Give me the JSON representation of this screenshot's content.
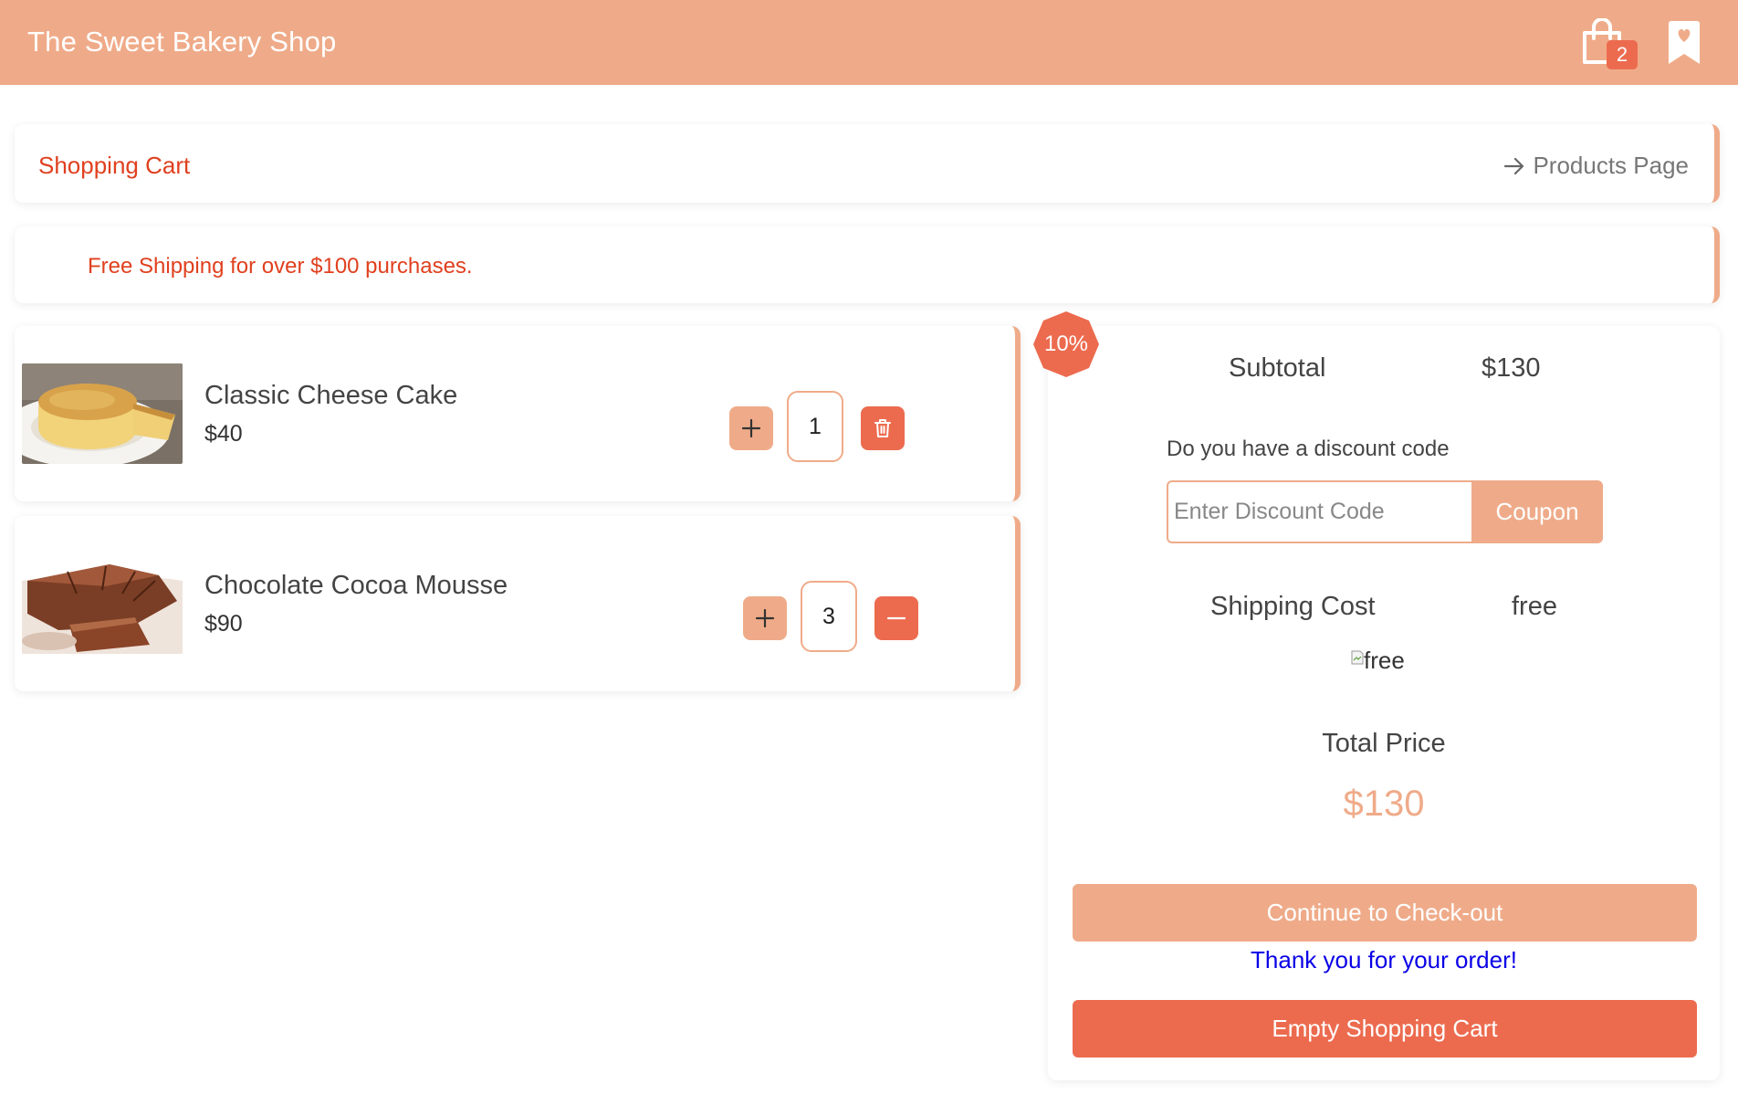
{
  "header": {
    "title": "The Sweet Bakery Shop",
    "cart_count": "2",
    "cart_icon": "shopping-bag-icon",
    "bookmark_icon": "bookmark-heart-icon"
  },
  "breadcrumb": {
    "title": "Shopping Cart",
    "products_link": "Products Page",
    "arrow_icon": "arrow-right-icon"
  },
  "notice": {
    "text": "Free Shipping for over $100 purchases."
  },
  "cart_items": [
    {
      "name": "Classic Cheese Cake",
      "price": "$40",
      "quantity": "1",
      "image_icon": "cheesecake-image",
      "plus_icon": "plus-icon",
      "remove_icon": "trash-icon"
    },
    {
      "name": "Chocolate Cocoa Mousse",
      "price": "$90",
      "quantity": "3",
      "image_icon": "chocolate-cake-image",
      "plus_icon": "plus-icon",
      "remove_icon": "minus-icon"
    }
  ],
  "summary": {
    "discount_badge": "10%",
    "subtotal_label": "Subtotal",
    "subtotal_value": "$130",
    "discount_question": "Do you have a discount code",
    "discount_placeholder": "Enter Discount Code",
    "coupon_label": "Coupon",
    "shipping_label": "Shipping Cost",
    "shipping_value": "free",
    "shipping_image_alt": "free",
    "total_label": "Total Price",
    "total_value": "$130",
    "checkout_label": "Continue to Check-out",
    "thank_you": "Thank you for your order!",
    "empty_label": "Empty Shopping Cart"
  },
  "colors": {
    "accent": "#efab89",
    "danger": "#ec6b4f",
    "link_red": "#e0401f",
    "thanks_blue": "#0a00e6"
  }
}
